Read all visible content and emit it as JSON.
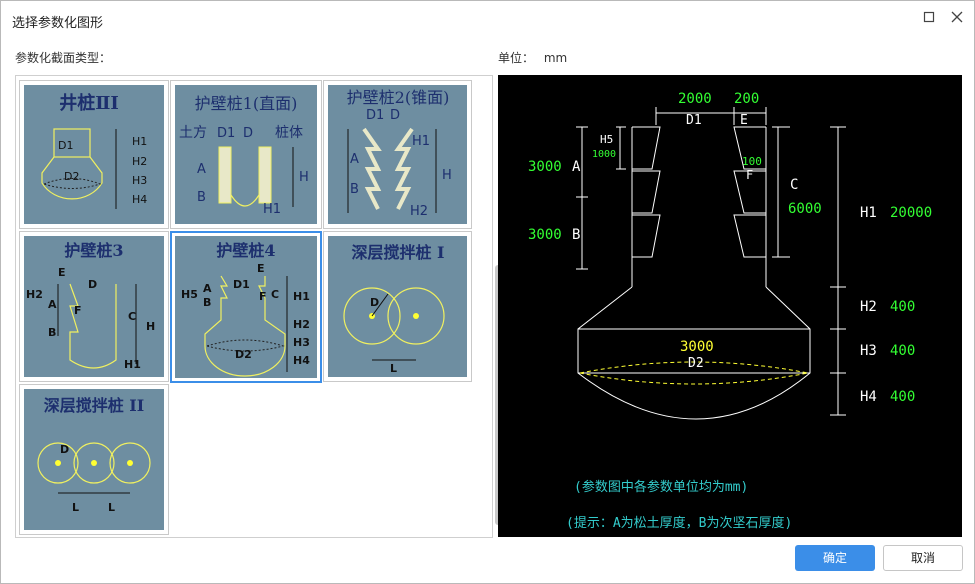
{
  "window": {
    "title": "选择参数化图形"
  },
  "labels": {
    "section_type": "参数化截面类型：",
    "unit_label": "单位：",
    "unit_value": "mm"
  },
  "thumbnails": [
    {
      "title": "井桩ⅡI",
      "selected": false,
      "labels": [
        "D1",
        "D2",
        "H1",
        "H2",
        "H3",
        "H4"
      ]
    },
    {
      "title": "护壁桩1(直面)",
      "selected": false,
      "labels": [
        "土方",
        "D1",
        "D",
        "桩体",
        "A",
        "B",
        "H",
        "H1"
      ]
    },
    {
      "title": "护壁桩2(锥面)",
      "selected": false,
      "labels": [
        "D1",
        "D",
        "A",
        "B",
        "H1",
        "H",
        "H2"
      ]
    },
    {
      "title": "护壁桩3",
      "selected": false,
      "labels": [
        "E",
        "D",
        "H2",
        "A",
        "F",
        "B",
        "C",
        "H",
        "H1"
      ]
    },
    {
      "title": "护壁桩4",
      "selected": true,
      "labels": [
        "E",
        "D1",
        "H5",
        "A",
        "B",
        "F",
        "C",
        "H1",
        "H2",
        "H3",
        "D2",
        "H4"
      ]
    },
    {
      "title": "深层搅拌桩 I",
      "selected": false,
      "labels": [
        "D",
        "L"
      ]
    },
    {
      "title": "深层搅拌桩 II",
      "selected": false,
      "labels": [
        "D",
        "L",
        "L"
      ]
    }
  ],
  "preview": {
    "top_dims": {
      "val1": "2000",
      "val2": "200",
      "lbl1": "D1",
      "lbl2": "E"
    },
    "left": {
      "a_val": "3000",
      "a_lbl": "A",
      "b_val": "3000",
      "b_lbl": "B",
      "h5_lbl": "H5",
      "h5_val": "1000"
    },
    "right": {
      "f_val": "100",
      "f_lbl": "F",
      "c_lbl": "C",
      "c_val": "6000",
      "h1_lbl": "H1",
      "h1_val": "20000",
      "h2_lbl": "H2",
      "h2_val": "400",
      "h3_lbl": "H3",
      "h3_val": "400",
      "h4_lbl": "H4",
      "h4_val": "400"
    },
    "bulb": {
      "d2_val": "3000",
      "d2_lbl": "D2"
    },
    "note1": "(参数图中各参数单位均为mm)",
    "note2": "(提示：A为松土厚度，B为次坚石厚度)"
  },
  "buttons": {
    "ok": "确定",
    "cancel": "取消"
  },
  "colors": {
    "accent": "#3b8ee8",
    "thumb_bg": "#6e8ea1",
    "thumb_title": "#1d2f6e",
    "preview_green": "#33ff33",
    "preview_cyan": "#33cccc"
  }
}
